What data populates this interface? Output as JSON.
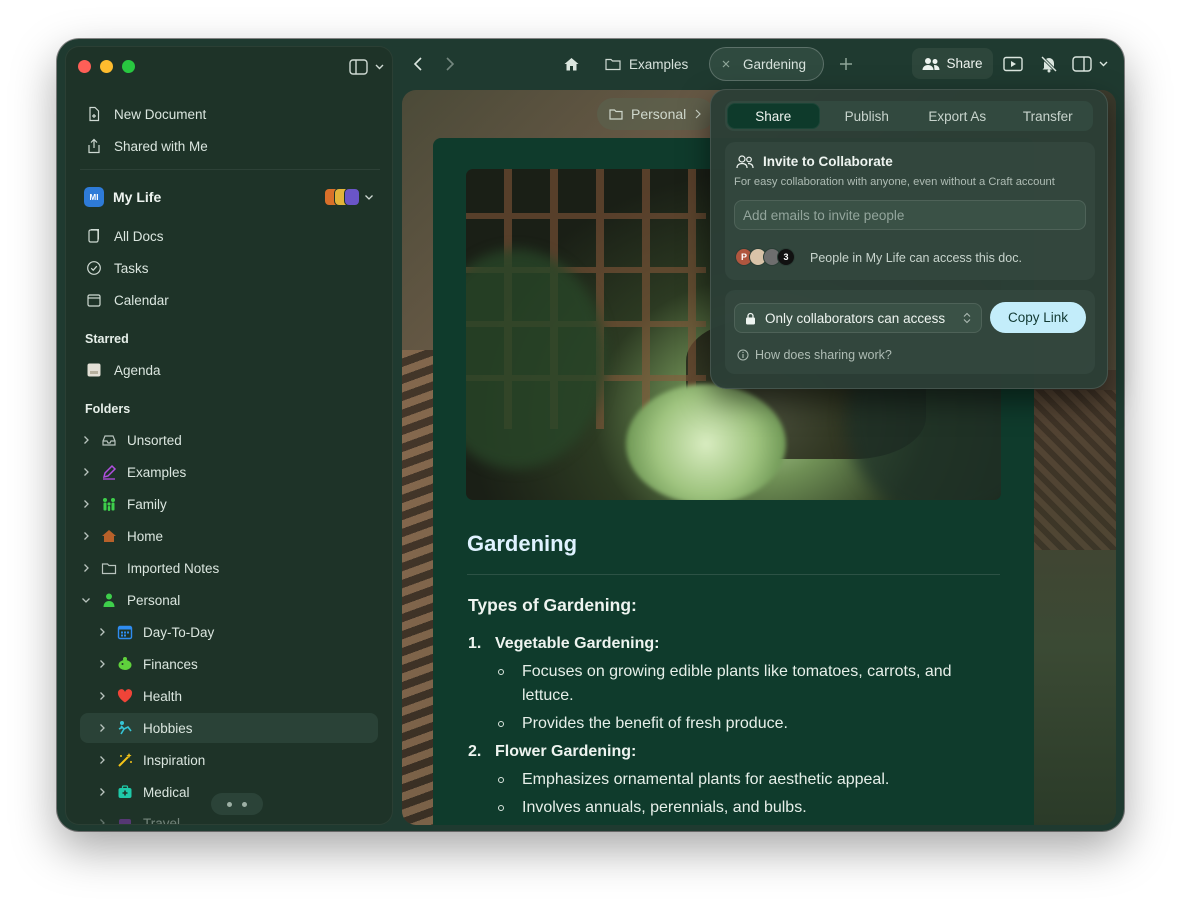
{
  "sidebar": {
    "new_document": "New Document",
    "shared_with_me": "Shared with Me",
    "space": {
      "badge": "MI",
      "name": "My Life"
    },
    "nav": [
      {
        "label": "All Docs"
      },
      {
        "label": "Tasks"
      },
      {
        "label": "Calendar"
      }
    ],
    "starred_title": "Starred",
    "starred": [
      {
        "label": "Agenda"
      }
    ],
    "folders_title": "Folders",
    "folders": [
      {
        "label": "Unsorted",
        "icon": "inbox-icon",
        "color": "#b9c4be"
      },
      {
        "label": "Examples",
        "icon": "pen-icon",
        "color": "#b14fe0"
      },
      {
        "label": "Family",
        "icon": "family-icon",
        "color": "#3ecf4b"
      },
      {
        "label": "Home",
        "icon": "house-icon",
        "color": "#b8612a"
      },
      {
        "label": "Imported Notes",
        "icon": "folder-icon",
        "color": "#b9c4be"
      },
      {
        "label": "Personal",
        "icon": "person-icon",
        "color": "#3ecf4b"
      }
    ],
    "subfolders": [
      {
        "label": "Day-To-Day",
        "icon": "calendar-grid-icon",
        "color": "#2f8cf0"
      },
      {
        "label": "Finances",
        "icon": "piggy-bank-icon",
        "color": "#5fd13c"
      },
      {
        "label": "Health",
        "icon": "heart-icon",
        "color": "#f04438"
      },
      {
        "label": "Hobbies",
        "icon": "hobby-icon",
        "color": "#35c5d6"
      },
      {
        "label": "Inspiration",
        "icon": "magic-wand-icon",
        "color": "#f5c518"
      },
      {
        "label": "Medical",
        "icon": "medical-kit-icon",
        "color": "#1fc9a8"
      },
      {
        "label": "Travel",
        "icon": "travel-icon",
        "color": "#9a3fd1"
      }
    ]
  },
  "toolbar": {
    "tabs": [
      {
        "label": "Examples"
      },
      {
        "label": "Gardening"
      }
    ],
    "share_label": "Share"
  },
  "content": {
    "breadcrumb": "Personal",
    "title": "Gardening",
    "heading": "Types of Gardening:",
    "items": [
      {
        "num": "1.",
        "head": "Vegetable Gardening:",
        "bullets": [
          "Focuses on growing edible plants like tomatoes, carrots, and lettuce.",
          "Provides the benefit of fresh produce."
        ]
      },
      {
        "num": "2.",
        "head": "Flower Gardening:",
        "bullets": [
          "Emphasizes ornamental plants for aesthetic appeal.",
          "Involves annuals, perennials, and bulbs."
        ]
      }
    ]
  },
  "share_popover": {
    "tabs": [
      "Share",
      "Publish",
      "Export As",
      "Transfer"
    ],
    "invite_title": "Invite to Collaborate",
    "invite_subtitle": "For easy collaboration with anyone, even without a Craft account",
    "email_placeholder": "Add emails to invite people",
    "people_count": "3",
    "people_initial": "P",
    "people_text": "People in My Life can access this doc.",
    "access_value": "Only collaborators can access",
    "copy_link": "Copy Link",
    "help": "How does sharing work?"
  }
}
